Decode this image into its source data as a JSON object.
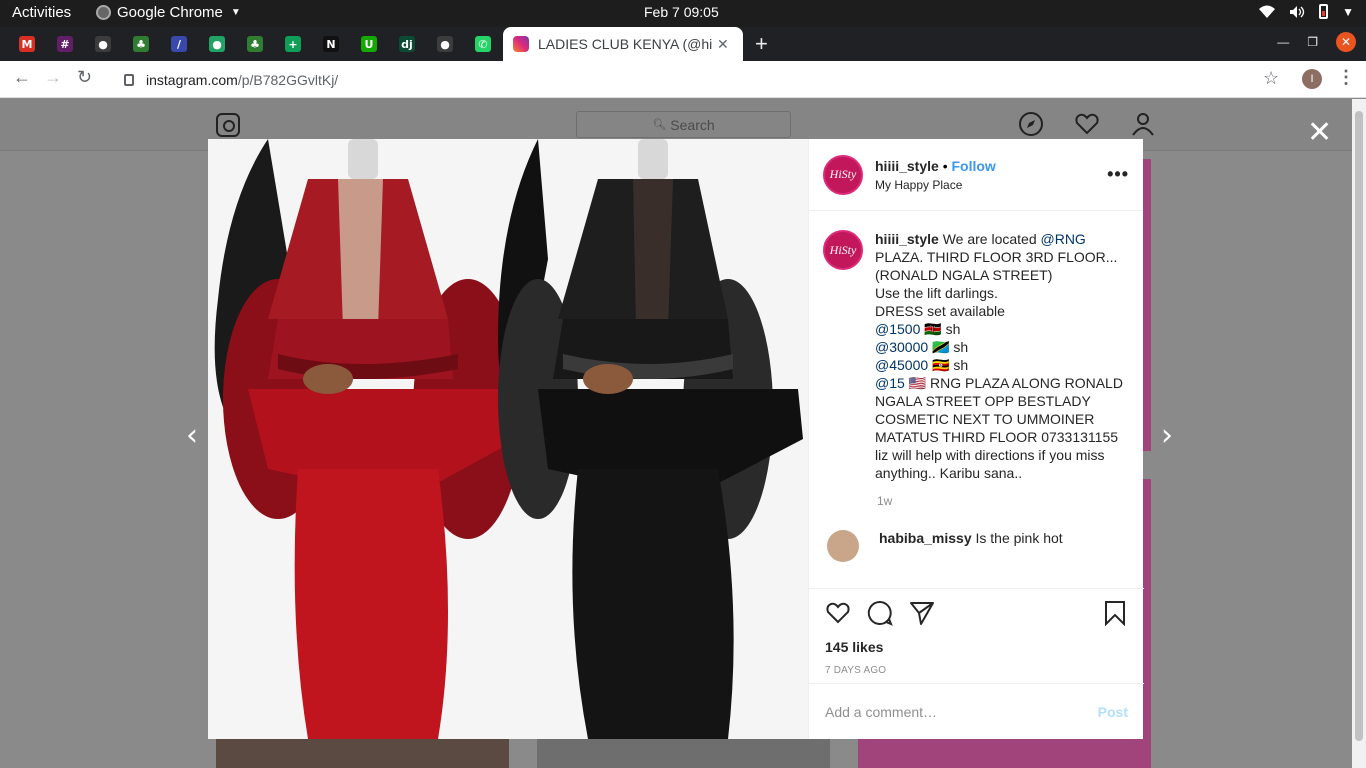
{
  "system": {
    "activities": "Activities",
    "app_name": "Google Chrome",
    "clock": "Feb 7  09:05"
  },
  "browser": {
    "pinned_tabs": [
      {
        "icon": "gmail-icon",
        "glyph": "M",
        "color": "#d93025"
      },
      {
        "icon": "slack-icon",
        "glyph": "#",
        "color": "#611f69"
      },
      {
        "icon": "github-icon",
        "glyph": "●",
        "color": "#3c3c3c"
      },
      {
        "icon": "palm-tree-icon",
        "glyph": "♣",
        "color": "#2e7d32"
      },
      {
        "icon": "pen-icon",
        "glyph": "/",
        "color": "#3949ab"
      },
      {
        "icon": "green-circle-icon",
        "glyph": "●",
        "color": "#21a366"
      },
      {
        "icon": "palm-tree-icon",
        "glyph": "♣",
        "color": "#2e7d32"
      },
      {
        "icon": "sheets-plus-icon",
        "glyph": "+",
        "color": "#0f9d58"
      },
      {
        "icon": "notion-icon",
        "glyph": "N",
        "color": "#111111"
      },
      {
        "icon": "upwork-icon",
        "glyph": "U",
        "color": "#14a800"
      },
      {
        "icon": "django-icon",
        "glyph": "dj",
        "color": "#0c4b33"
      },
      {
        "icon": "github-icon",
        "glyph": "●",
        "color": "#3c3c3c"
      },
      {
        "icon": "whatsapp-icon",
        "glyph": "✆",
        "color": "#25d366"
      }
    ],
    "active_tab_title": "LADIES CLUB KENYA (@hiiii_style)",
    "url_domain": "instagram.com",
    "url_path": "/p/B782GGvltKj/",
    "profile_initial": "I"
  },
  "instagram": {
    "search_placeholder": "Search",
    "post": {
      "username": "hiiii_style",
      "separator": " • ",
      "follow_label": "Follow",
      "location": "My Happy Place",
      "avatar_text": "HiSty",
      "caption_lines": [
        {
          "text": "We are located ",
          "mention": "@RNG"
        },
        {
          "text": "PLAZA. THIRD FLOOR 3RD FLOOR... (RONALD NGALA STREET)"
        },
        {
          "text": "Use the lift darlings."
        },
        {
          "text": "DRESS set available"
        },
        {
          "mention": "@1500",
          "text": " 🇰🇪 sh"
        },
        {
          "mention": "@30000",
          "text": " 🇹🇿 sh"
        },
        {
          "mention": "@45000",
          "text": " 🇺🇬 sh"
        },
        {
          "mention": "@15",
          "text": " 🇺🇸 RNG PLAZA ALONG RONALD NGALA STREET OPP BESTLADY COSMETIC NEXT TO UMMOINER MATATUS THIRD FLOOR 0733131155 liz will help with directions if you miss anything.. Karibu sana.."
        }
      ],
      "caption_age": "1w",
      "next_comment_user": "habiba_missy",
      "next_comment_text": "Is the pink hot",
      "likes": "145 likes",
      "posted": "7 DAYS AGO",
      "comment_placeholder": "Add a comment…",
      "post_label": "Post"
    }
  },
  "colors": {
    "follow": "#3897f0",
    "mention": "#003569",
    "dress_red": "#c0141f",
    "dress_black": "#141414"
  }
}
